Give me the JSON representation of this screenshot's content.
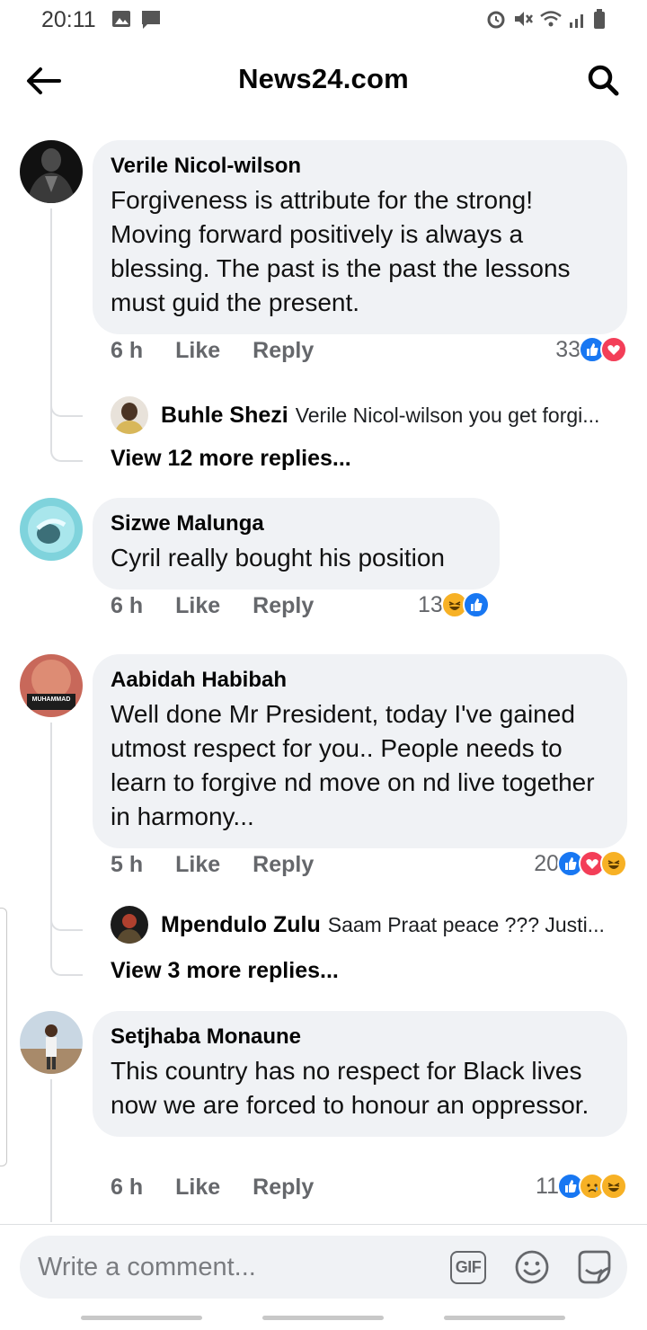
{
  "status_bar": {
    "time": "20:11"
  },
  "header": {
    "title": "News24.com"
  },
  "comments": [
    {
      "author": "Verile Nicol-wilson",
      "text": "Forgiveness is attribute for the strong! Moving forward positively is always a blessing. The past is the past  the lessons must guid the present.",
      "time": "6 h",
      "like_label": "Like",
      "reply_label": "Reply",
      "reaction_count": "33",
      "reactions": [
        "like",
        "love"
      ],
      "reply_preview": {
        "author": "Buhle Shezi",
        "text": "Verile Nicol-wilson you get forgi..."
      },
      "view_more": "View 12 more replies..."
    },
    {
      "author": "Sizwe Malunga",
      "text": "Cyril really bought his position",
      "time": "6 h",
      "like_label": "Like",
      "reply_label": "Reply",
      "reaction_count": "13",
      "reactions": [
        "haha",
        "like"
      ]
    },
    {
      "author": "Aabidah Habibah",
      "text": "Well done Mr President, today I've gained utmost respect for you.. People needs to learn to forgive nd move on nd live together in harmony...",
      "time": "5 h",
      "like_label": "Like",
      "reply_label": "Reply",
      "reaction_count": "20",
      "reactions": [
        "like",
        "love",
        "haha"
      ],
      "avatar_caption": "MUHAMMAD",
      "reply_preview": {
        "author": "Mpendulo Zulu",
        "text": "Saam Praat peace ??? Justi..."
      },
      "view_more": "View 3 more replies..."
    },
    {
      "author": "Setjhaba Monaune",
      "text": "This country has no respect for Black lives now we are forced to honour an oppressor.",
      "time": "6 h",
      "like_label": "Like",
      "reply_label": "Reply",
      "reaction_count": "11",
      "reactions": [
        "like",
        "sad",
        "haha"
      ]
    }
  ],
  "composer": {
    "placeholder": "Write a comment...",
    "gif_label": "GIF"
  },
  "icons": [
    "back-arrow-icon",
    "search-icon",
    "gif-icon",
    "emoji-icon",
    "sticker-icon",
    "like-reaction-icon",
    "love-reaction-icon",
    "haha-reaction-icon",
    "sad-reaction-icon"
  ],
  "colors": {
    "bubble": "#f0f2f5",
    "like": "#1877f2",
    "love": "#f33e58",
    "haha": "#f7b125",
    "secondary_text": "#65676b"
  }
}
